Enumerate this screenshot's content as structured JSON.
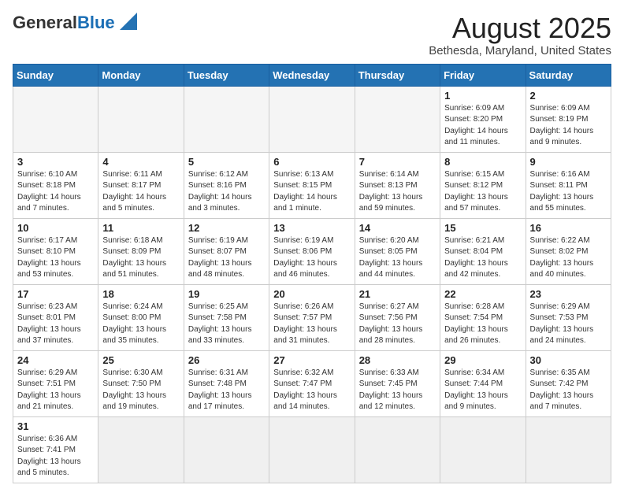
{
  "header": {
    "logo_general": "General",
    "logo_blue": "Blue",
    "month_year": "August 2025",
    "location": "Bethesda, Maryland, United States"
  },
  "weekdays": [
    "Sunday",
    "Monday",
    "Tuesday",
    "Wednesday",
    "Thursday",
    "Friday",
    "Saturday"
  ],
  "weeks": [
    [
      {
        "day": "",
        "info": ""
      },
      {
        "day": "",
        "info": ""
      },
      {
        "day": "",
        "info": ""
      },
      {
        "day": "",
        "info": ""
      },
      {
        "day": "",
        "info": ""
      },
      {
        "day": "1",
        "info": "Sunrise: 6:09 AM\nSunset: 8:20 PM\nDaylight: 14 hours and 11 minutes."
      },
      {
        "day": "2",
        "info": "Sunrise: 6:09 AM\nSunset: 8:19 PM\nDaylight: 14 hours and 9 minutes."
      }
    ],
    [
      {
        "day": "3",
        "info": "Sunrise: 6:10 AM\nSunset: 8:18 PM\nDaylight: 14 hours and 7 minutes."
      },
      {
        "day": "4",
        "info": "Sunrise: 6:11 AM\nSunset: 8:17 PM\nDaylight: 14 hours and 5 minutes."
      },
      {
        "day": "5",
        "info": "Sunrise: 6:12 AM\nSunset: 8:16 PM\nDaylight: 14 hours and 3 minutes."
      },
      {
        "day": "6",
        "info": "Sunrise: 6:13 AM\nSunset: 8:15 PM\nDaylight: 14 hours and 1 minute."
      },
      {
        "day": "7",
        "info": "Sunrise: 6:14 AM\nSunset: 8:13 PM\nDaylight: 13 hours and 59 minutes."
      },
      {
        "day": "8",
        "info": "Sunrise: 6:15 AM\nSunset: 8:12 PM\nDaylight: 13 hours and 57 minutes."
      },
      {
        "day": "9",
        "info": "Sunrise: 6:16 AM\nSunset: 8:11 PM\nDaylight: 13 hours and 55 minutes."
      }
    ],
    [
      {
        "day": "10",
        "info": "Sunrise: 6:17 AM\nSunset: 8:10 PM\nDaylight: 13 hours and 53 minutes."
      },
      {
        "day": "11",
        "info": "Sunrise: 6:18 AM\nSunset: 8:09 PM\nDaylight: 13 hours and 51 minutes."
      },
      {
        "day": "12",
        "info": "Sunrise: 6:19 AM\nSunset: 8:07 PM\nDaylight: 13 hours and 48 minutes."
      },
      {
        "day": "13",
        "info": "Sunrise: 6:19 AM\nSunset: 8:06 PM\nDaylight: 13 hours and 46 minutes."
      },
      {
        "day": "14",
        "info": "Sunrise: 6:20 AM\nSunset: 8:05 PM\nDaylight: 13 hours and 44 minutes."
      },
      {
        "day": "15",
        "info": "Sunrise: 6:21 AM\nSunset: 8:04 PM\nDaylight: 13 hours and 42 minutes."
      },
      {
        "day": "16",
        "info": "Sunrise: 6:22 AM\nSunset: 8:02 PM\nDaylight: 13 hours and 40 minutes."
      }
    ],
    [
      {
        "day": "17",
        "info": "Sunrise: 6:23 AM\nSunset: 8:01 PM\nDaylight: 13 hours and 37 minutes."
      },
      {
        "day": "18",
        "info": "Sunrise: 6:24 AM\nSunset: 8:00 PM\nDaylight: 13 hours and 35 minutes."
      },
      {
        "day": "19",
        "info": "Sunrise: 6:25 AM\nSunset: 7:58 PM\nDaylight: 13 hours and 33 minutes."
      },
      {
        "day": "20",
        "info": "Sunrise: 6:26 AM\nSunset: 7:57 PM\nDaylight: 13 hours and 31 minutes."
      },
      {
        "day": "21",
        "info": "Sunrise: 6:27 AM\nSunset: 7:56 PM\nDaylight: 13 hours and 28 minutes."
      },
      {
        "day": "22",
        "info": "Sunrise: 6:28 AM\nSunset: 7:54 PM\nDaylight: 13 hours and 26 minutes."
      },
      {
        "day": "23",
        "info": "Sunrise: 6:29 AM\nSunset: 7:53 PM\nDaylight: 13 hours and 24 minutes."
      }
    ],
    [
      {
        "day": "24",
        "info": "Sunrise: 6:29 AM\nSunset: 7:51 PM\nDaylight: 13 hours and 21 minutes."
      },
      {
        "day": "25",
        "info": "Sunrise: 6:30 AM\nSunset: 7:50 PM\nDaylight: 13 hours and 19 minutes."
      },
      {
        "day": "26",
        "info": "Sunrise: 6:31 AM\nSunset: 7:48 PM\nDaylight: 13 hours and 17 minutes."
      },
      {
        "day": "27",
        "info": "Sunrise: 6:32 AM\nSunset: 7:47 PM\nDaylight: 13 hours and 14 minutes."
      },
      {
        "day": "28",
        "info": "Sunrise: 6:33 AM\nSunset: 7:45 PM\nDaylight: 13 hours and 12 minutes."
      },
      {
        "day": "29",
        "info": "Sunrise: 6:34 AM\nSunset: 7:44 PM\nDaylight: 13 hours and 9 minutes."
      },
      {
        "day": "30",
        "info": "Sunrise: 6:35 AM\nSunset: 7:42 PM\nDaylight: 13 hours and 7 minutes."
      }
    ],
    [
      {
        "day": "31",
        "info": "Sunrise: 6:36 AM\nSunset: 7:41 PM\nDaylight: 13 hours and 5 minutes."
      },
      {
        "day": "",
        "info": ""
      },
      {
        "day": "",
        "info": ""
      },
      {
        "day": "",
        "info": ""
      },
      {
        "day": "",
        "info": ""
      },
      {
        "day": "",
        "info": ""
      },
      {
        "day": "",
        "info": ""
      }
    ]
  ]
}
